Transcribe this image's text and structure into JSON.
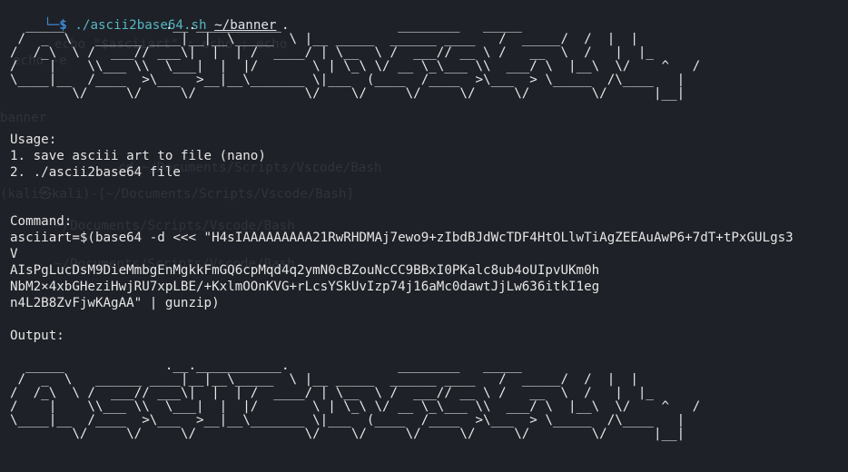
{
  "prompt": {
    "tree": "└─",
    "dollar": "$",
    "command": "./ascii2base64.sh",
    "argument": "~/banner"
  },
  "banner_art": "  _____             .__.___________.              ________   _____  \n /  _  \\   ______ ____|__|__\\_____  \\ |__ _____  ______ ____   /  _____/  /  |  | \n/  /_\\  \\ /  ___// ___\\|  |  | /  ____/ | \\__  \\ /  ___// __ \\ /   __  \\  /   |  |_\n/    |    \\\\___ \\\\  \\___|  |  |/       \\ | \\_\\ \\/ __ \\_\\___ \\\\  ___/ \\  |__\\  \\/    ^   /\n\\____|__  /____  >\\___  >__|__\\_______ \\|___  (____  /____  >\\___  > \\_____  /\\____   | \n        \\/     \\/     \\/              \\/    \\/     \\/     \\/     \\/        \\/      |__| ",
  "usage": {
    "heading": "Usage:",
    "step1": "1. save asciii art to file (nano)",
    "step2": "2. ./ascii2base64 file"
  },
  "command": {
    "heading": "Command:",
    "line1": "asciiart=$(base64 -d <<< \"H4sIAAAAAAAAA21RwRHDMAj7ewo9+zIbdBJdWcTDF4HtOLlwTiAgZEEAuAwP6+7dT+tPxGULgs3",
    "line2": "V",
    "line3": "AIsPgLucDsM9DieMmbgEnMgkkFmGQ6cpMqd4q2ymN0cBZouNcCC9BBxI0PKalc8ub4oUIpvUKm0h",
    "line4": "NbM2×4xbGHeziHwjRU7xpLBE/+KxlmOOnKVG+rLcsYSkUvIzp74j16aMc0dawtJjLw636itkI1eg",
    "line5": "n4L2B8ZvFjwKAgAA\" | gunzip)"
  },
  "output": {
    "heading": "Output:"
  },
  "ghost": {
    "l1": "echo -e",
    "l2": "echo \"$asciiart\" ; echo ; echo",
    "l3": "echo -e",
    "l4": "banner",
    "l5": "cd ~/Documents/Scripts/Vscode/Bash",
    "l6": "(kali㉿kali)-[~/Documents/Scripts/Vscode/Bash]",
    "l7": "~/Documents/Scripts/Vscode/Bash",
    "l8": "~/Documents/Scripts/Vscode/Bash"
  },
  "colors": {
    "background": "#1e2127",
    "text": "#e6e6e6",
    "prompt_blue": "#3f8ad6",
    "command_cyan": "#56b6c2",
    "ghost": "#2f333b"
  }
}
